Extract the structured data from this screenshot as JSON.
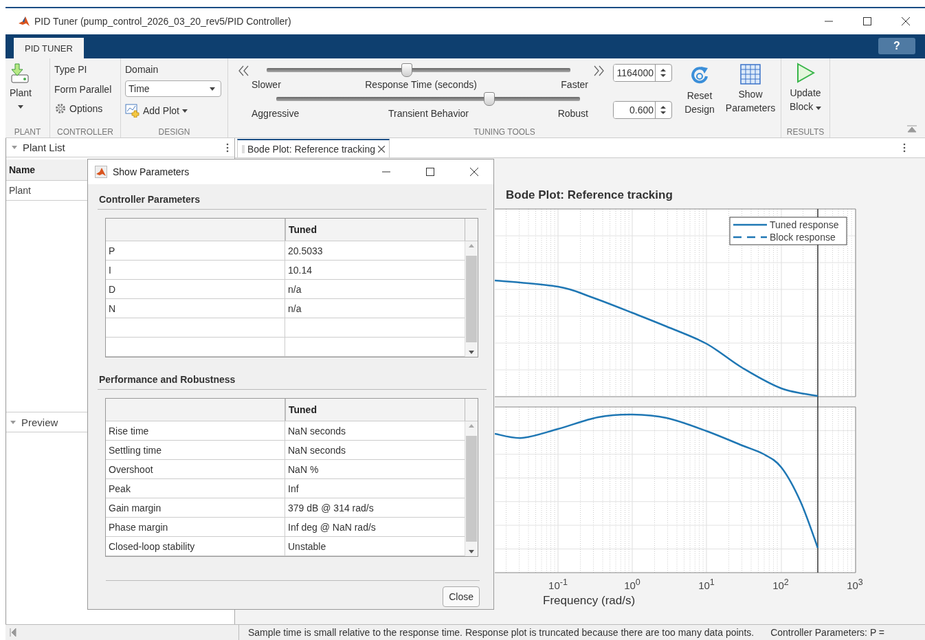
{
  "window": {
    "title": "PID Tuner (pump_control_2026_03_20_rev5/PID Controller)"
  },
  "ribbon_tabs": [
    {
      "label": "PID TUNER",
      "selected": true
    }
  ],
  "help": "?",
  "plant_section": {
    "button": "Plant",
    "label": "PLANT"
  },
  "controller_section": {
    "type": "Type PI",
    "form": "Form Parallel",
    "options": "Options",
    "label": "CONTROLLER"
  },
  "design_section": {
    "domain_label": "Domain",
    "domain_value": "Time",
    "add_plot": "Add Plot",
    "label": "DESIGN"
  },
  "tuning_tools": {
    "label": "TUNING TOOLS",
    "sliders": [
      {
        "left": "Slower",
        "center": "Response Time (seconds)",
        "right": "Faster",
        "level": 0.46,
        "value": "1164000"
      },
      {
        "left": "Aggressive",
        "center": "Transient Behavior",
        "right": "Robust",
        "level": 0.7,
        "value": "0.600"
      }
    ],
    "buttons": [
      {
        "label": "Reset Design",
        "kind": "reset"
      },
      {
        "label": "Show Parameters",
        "kind": "table"
      }
    ]
  },
  "results_section": {
    "button": "Update Block",
    "label": "RESULTS"
  },
  "plant_list": {
    "title": "Plant List",
    "column": "Name",
    "rows": [
      "Plant"
    ]
  },
  "preview": {
    "title": "Preview"
  },
  "document_tabs": [
    {
      "label": "Bode Plot: Reference tracking",
      "selected": true
    }
  ],
  "plot": {
    "title": "Bode Plot: Reference tracking",
    "legend": [
      {
        "label": "Tuned response",
        "kind": "solid"
      },
      {
        "label": "Block response",
        "kind": "dashed"
      }
    ],
    "xticks": [
      "10$^{-1}$",
      "10$^{0}$",
      "10$^{1}$",
      "10$^{2}$",
      "10$^{3}$"
    ],
    "xlabel": "Frequency  (rad/s)"
  },
  "dialog": {
    "title": "Show Parameters",
    "sections": [
      {
        "title": "Controller Parameters",
        "column": "Tuned",
        "rows": [
          [
            "P",
            "20.5033"
          ],
          [
            "I",
            "10.14"
          ],
          [
            "D",
            "n/a"
          ],
          [
            "N",
            "n/a"
          ]
        ]
      },
      {
        "title": "Performance and Robustness",
        "column": "Tuned",
        "rows": [
          [
            "Rise time",
            "NaN seconds"
          ],
          [
            "Settling time",
            "NaN seconds"
          ],
          [
            "Overshoot",
            "NaN %"
          ],
          [
            "Peak",
            "Inf"
          ],
          [
            "Gain margin",
            "379 dB @ 314 rad/s"
          ],
          [
            "Phase margin",
            "Inf deg @ NaN rad/s"
          ],
          [
            "Closed-loop stability",
            "Unstable"
          ]
        ]
      }
    ],
    "close": "Close"
  },
  "status_bar": {
    "message": "Sample time is small relative to the response time. Response plot is truncated because there are too many data points.",
    "right": "Controller Parameters: P ="
  }
}
